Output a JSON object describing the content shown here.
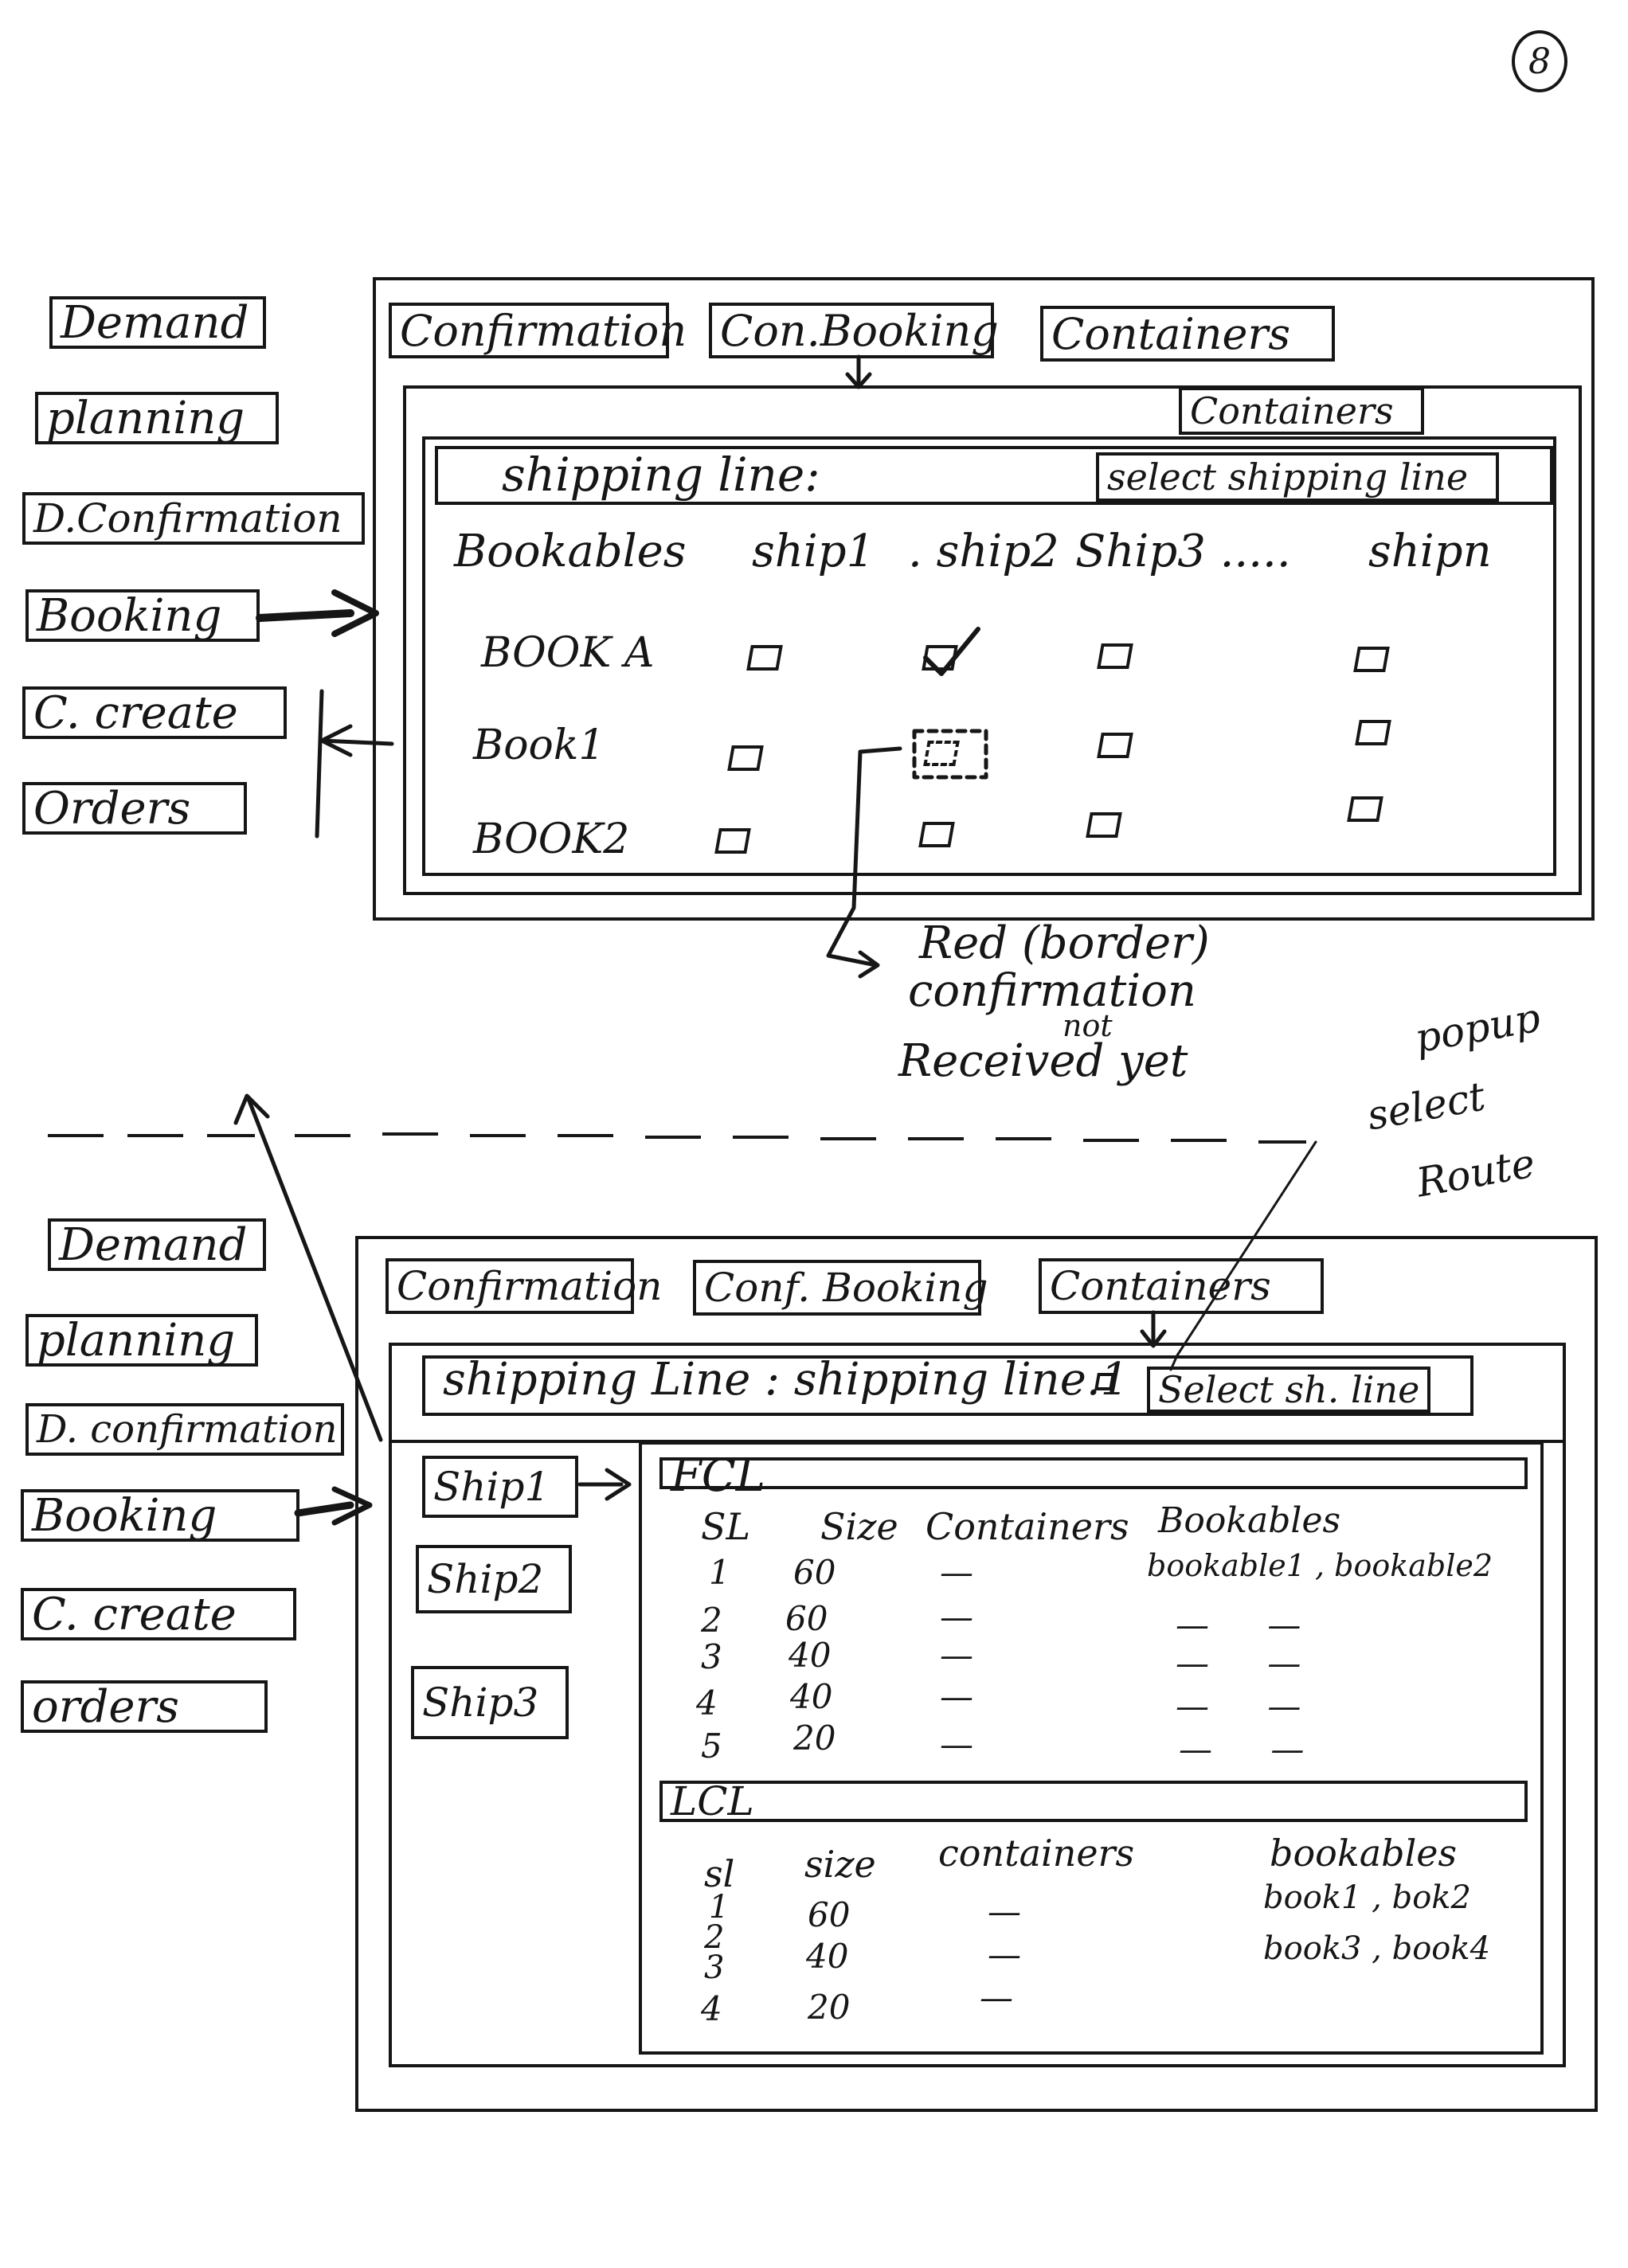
{
  "page_number": "8",
  "top": {
    "sidebar": [
      "Demand",
      "planning",
      "D.Confirmation",
      "Booking",
      "C. create",
      "Orders"
    ],
    "tabs": [
      "Confirmation",
      "Con.Booking",
      "Containers"
    ],
    "inner_button": "Containers",
    "shipping_label": "shipping line:",
    "select_button": "select shipping line",
    "header": [
      "Bookables",
      "ship1",
      ". ship2",
      "Ship3 .....",
      "shipn"
    ],
    "rows": [
      "BOOK A",
      "Book1",
      "BOOK2"
    ],
    "annotation": [
      "Red (border)",
      "confirmation",
      "not",
      "Received yet"
    ]
  },
  "popup_note": [
    "popup",
    "select",
    "Route"
  ],
  "bottom": {
    "sidebar": [
      "Demand",
      "planning",
      "D. confirmation",
      "Booking",
      "C. create",
      "orders"
    ],
    "tabs": [
      "Confirmation",
      "Conf. Booking",
      "Containers"
    ],
    "shipping_text": "shipping Line : shipping line.1",
    "select_button": "Select sh. line",
    "ships": [
      "Ship1",
      "Ship2",
      "Ship3"
    ],
    "fcl": {
      "title": "FCL",
      "headers": [
        "SL",
        "Size",
        "Containers",
        "Bookables"
      ],
      "rows": [
        {
          "sl": "1",
          "size": "60",
          "containers": "—",
          "bookables": "bookable1 , bookable2"
        },
        {
          "sl": "2",
          "size": "60",
          "containers": "—",
          "bookables": "— —"
        },
        {
          "sl": "3",
          "size": "40",
          "containers": "—",
          "bookables": "— —"
        },
        {
          "sl": "4",
          "size": "40",
          "containers": "—",
          "bookables": "— —"
        },
        {
          "sl": "5",
          "size": "20",
          "containers": "—",
          "bookables": "— —"
        }
      ]
    },
    "lcl": {
      "title": "LCL",
      "headers": [
        "sl",
        "size",
        "containers",
        "bookables"
      ],
      "rows": [
        {
          "sl": "1",
          "size": "60",
          "containers": "—",
          "bookables": "book1 , bok2"
        },
        {
          "sl": "2",
          "size": "40",
          "containers": "—",
          "bookables": "book3 , book4"
        },
        {
          "sl": "3",
          "size": "",
          "containers": "",
          "bookables": ""
        },
        {
          "sl": "4",
          "size": "20",
          "containers": "—",
          "bookables": ""
        }
      ]
    }
  }
}
